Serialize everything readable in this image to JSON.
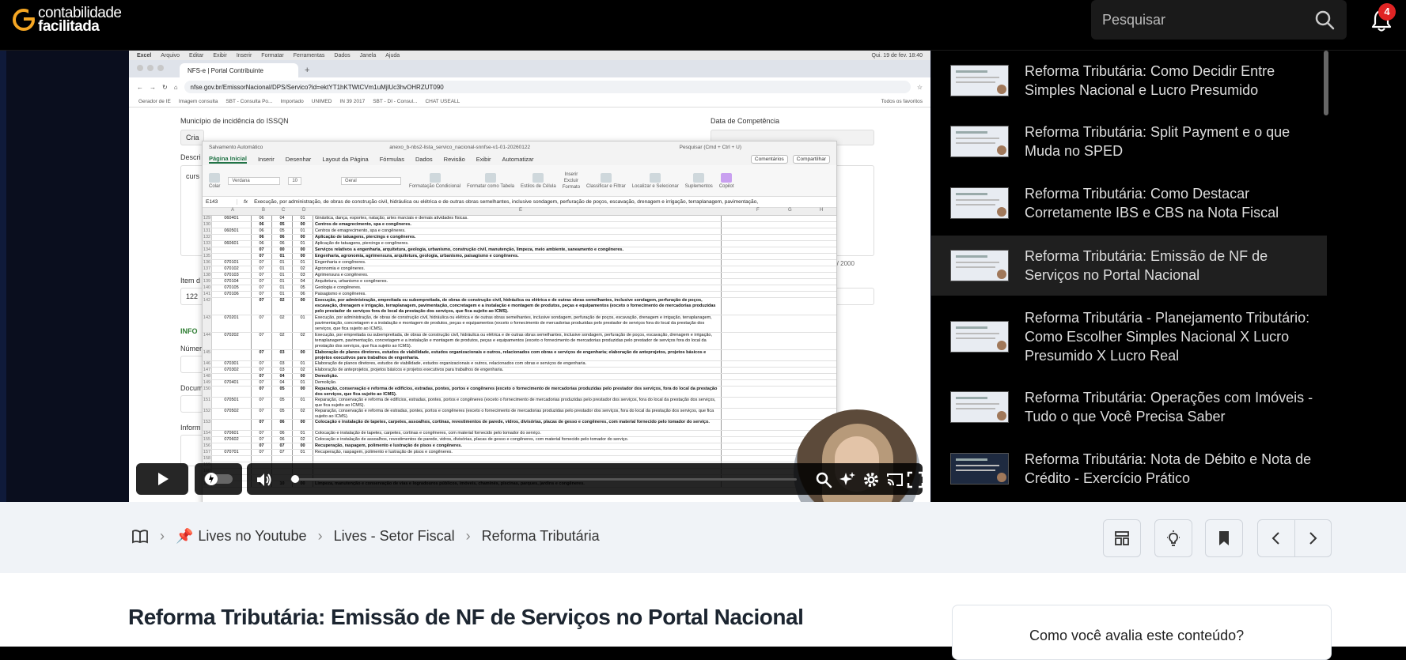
{
  "header": {
    "logo_line1": "contabilidade",
    "logo_line2": "facilitada",
    "search_placeholder": "Pesquisar",
    "notification_count": "4"
  },
  "video": {
    "screen": {
      "mac_menu": [
        "Excel",
        "Arquivo",
        "Editar",
        "Exibir",
        "Inserir",
        "Formatar",
        "Ferramentas",
        "Dados",
        "Janela",
        "Ajuda"
      ],
      "mac_clock": "Qui. 19 de fev. 18:40",
      "browser_tab": "NFS-e | Portal Contribuinte",
      "url": "nfse.gov.br/EmissorNacional/DPS/Servico?id=ektYT1hKTWtCVm1uMjlUc3hvOHRZUT090",
      "bookmarks": [
        "Gerador de IE",
        "Imagem consulta",
        "SBT - Consulta Po...",
        "Importado",
        "UNIMED",
        "IN 39 2017",
        "SBT - DI - Consul...",
        "CHAT USEALL"
      ],
      "bookmarks_right": "Todos os favoritos",
      "form": {
        "municipio_label": "Município de incidência do ISSQN",
        "data_competencia_label": "Data de Competência",
        "criar_prefix": "Cria",
        "descr_label": "Descri",
        "curso_prefix": "curs",
        "chars_counter": "res: 66 / 2000",
        "item_label": "Item d",
        "item_value": "122",
        "info_label": "INFO",
        "numero_label": "Númer",
        "documento_label": "Docum",
        "informacoes_label": "Inform"
      },
      "excel": {
        "title": "anexo_b-nbs2-lista_servico_nacional-snnfse-v1-01-20260122",
        "autosave": "Salvamento Automático",
        "search": "Pesquisar (Cmd + Ctrl + U)",
        "menu": [
          "Página Inicial",
          "Inserir",
          "Desenhar",
          "Layout da Página",
          "Fórmulas",
          "Dados",
          "Revisão",
          "Exibir",
          "Automatizar"
        ],
        "comments_btn": "Comentários",
        "share_btn": "Compartilhar",
        "ribbon": [
          "Colar",
          "Verdana",
          "10",
          "Geral",
          "Formatação Condicional",
          "Formatar como Tabela",
          "Estilos de Célula",
          "Inserir",
          "Excluir",
          "Formato",
          "Classificar e Filtrar",
          "Localizar e Selecionar",
          "Suplementos",
          "Copilot"
        ],
        "cell_ref": "E143",
        "formula": "Execução, por administração, de obras de construção civil, hidráulica ou elétrica e de outras obras semelhantes, inclusive sondagem, perfuração de poços, escavação, drenagem e irrigação, terraplanagem, pavimentação,",
        "columns": [
          "A",
          "B",
          "C",
          "D",
          "E",
          "F",
          "G",
          "H"
        ],
        "rows": [
          {
            "n": "129",
            "a": "060401",
            "b": "06",
            "c": "04",
            "d": "01",
            "e": "Ginástica, dança, esportes, natação, artes marciais e demais atividades físicas.",
            "bold": false
          },
          {
            "n": "130",
            "a": "",
            "b": "06",
            "c": "05",
            "d": "00",
            "e": "Centros de emagrecimento, spa e congêneres.",
            "bold": true
          },
          {
            "n": "131",
            "a": "060501",
            "b": "06",
            "c": "05",
            "d": "01",
            "e": "Centros de emagrecimento, spa e congêneres.",
            "bold": false
          },
          {
            "n": "132",
            "a": "",
            "b": "06",
            "c": "06",
            "d": "00",
            "e": "Aplicação de tatuagens, piercings e congêneres.",
            "bold": true
          },
          {
            "n": "133",
            "a": "060601",
            "b": "06",
            "c": "06",
            "d": "01",
            "e": "Aplicação de tatuagens, piercings e congêneres.",
            "bold": false
          },
          {
            "n": "134",
            "a": "",
            "b": "07",
            "c": "00",
            "d": "00",
            "e": "Serviços relativos a engenharia, arquitetura, geologia, urbanismo, construção civil, manutenção, limpeza, meio ambiente, saneamento e congêneres.",
            "bold": true
          },
          {
            "n": "135",
            "a": "",
            "b": "07",
            "c": "01",
            "d": "00",
            "e": "Engenharia, agronomia, agrimensura, arquitetura, geologia, urbanismo, paisagismo e congêneres.",
            "bold": true
          },
          {
            "n": "136",
            "a": "070101",
            "b": "07",
            "c": "01",
            "d": "01",
            "e": "Engenharia e congêneres.",
            "bold": false
          },
          {
            "n": "137",
            "a": "070102",
            "b": "07",
            "c": "01",
            "d": "02",
            "e": "Agronomia e congêneres.",
            "bold": false
          },
          {
            "n": "138",
            "a": "070103",
            "b": "07",
            "c": "01",
            "d": "03",
            "e": "Agrimensura e congêneres.",
            "bold": false
          },
          {
            "n": "139",
            "a": "070104",
            "b": "07",
            "c": "01",
            "d": "04",
            "e": "Arquitetura, urbanismo e congêneres.",
            "bold": false
          },
          {
            "n": "140",
            "a": "070105",
            "b": "07",
            "c": "01",
            "d": "05",
            "e": "Geologia e congêneres.",
            "bold": false
          },
          {
            "n": "141",
            "a": "070106",
            "b": "07",
            "c": "01",
            "d": "06",
            "e": "Paisagismo e congêneres.",
            "bold": false
          },
          {
            "n": "142",
            "a": "",
            "b": "07",
            "c": "02",
            "d": "00",
            "e": "Execução, por administração, empreitada ou subempreitada, de obras de construção civil, hidráulica ou elétrica e de outras obras semelhantes, inclusive sondagem, perfuração de poços, escavação, drenagem e irrigação, terraplanagem, pavimentação, concretagem e a instalação e montagem de produtos, peças e equipamentos (exceto o fornecimento de mercadorias produzidas pelo prestador de serviços fora do local da prestação dos serviços, que fica sujeito ao ICMS).",
            "bold": true,
            "h": "tall"
          },
          {
            "n": "143",
            "a": "070201",
            "b": "07",
            "c": "02",
            "d": "01",
            "e": "Execução, por administração, de obras de construção civil, hidráulica ou elétrica e de outras obras semelhantes, inclusive sondagem, perfuração de poços, escavação, drenagem e irrigação, terraplanagem, pavimentação, concretagem e a instalação e montagem de produtos, peças e equipamentos (exceto o fornecimento de mercadorias produzidas pelo prestador de serviços fora do local da prestação dos serviços, que fica sujeito ao ICMS).",
            "bold": false,
            "h": "tall"
          },
          {
            "n": "144",
            "a": "070202",
            "b": "07",
            "c": "02",
            "d": "02",
            "e": "Execução, por empreitada ou subempreitada, de obras de construção civil, hidráulica ou elétrica e de outras obras semelhantes, inclusive sondagem, perfuração de poços, escavação, drenagem e irrigação, terraplanagem, pavimentação, concretagem e a instalação e montagem de produtos, peças e equipamentos (exceto o fornecimento de mercadorias produzidas pelo prestador de serviços fora do local da prestação dos serviços, que fica sujeito ao ICMS).",
            "bold": false,
            "h": "tall"
          },
          {
            "n": "145",
            "a": "",
            "b": "07",
            "c": "03",
            "d": "00",
            "e": "Elaboração de planos diretores, estudos de viabilidade, estudos organizacionais e outros, relacionados com obras e serviços de engenharia; elaboração de anteprojetos, projetos básicos e projetos executivos para trabalhos de engenharia.",
            "bold": true,
            "h": "mid"
          },
          {
            "n": "146",
            "a": "070301",
            "b": "07",
            "c": "03",
            "d": "01",
            "e": "Elaboração de planos diretores, estudos de viabilidade, estudos organizacionais e outros, relacionados com obras e serviços de engenharia.",
            "bold": false
          },
          {
            "n": "147",
            "a": "070302",
            "b": "07",
            "c": "03",
            "d": "02",
            "e": "Elaboração de anteprojetos, projetos básicos e projetos executivos para trabalhos de engenharia.",
            "bold": false
          },
          {
            "n": "148",
            "a": "",
            "b": "07",
            "c": "04",
            "d": "00",
            "e": "Demolição.",
            "bold": true
          },
          {
            "n": "149",
            "a": "070401",
            "b": "07",
            "c": "04",
            "d": "01",
            "e": "Demolição.",
            "bold": false
          },
          {
            "n": "150",
            "a": "",
            "b": "07",
            "c": "05",
            "d": "00",
            "e": "Reparação, conservação e reforma de edifícios, estradas, pontes, portos e congêneres (exceto o fornecimento de mercadorias produzidas pelo prestador dos serviços, fora do local da prestação dos serviços, que fica sujeito ao ICMS).",
            "bold": true,
            "h": "mid"
          },
          {
            "n": "151",
            "a": "070501",
            "b": "07",
            "c": "05",
            "d": "01",
            "e": "Reparação, conservação e reforma de edifícios, estradas, pontes, portos e congêneres (exceto o fornecimento de mercadorias produzidas pelo prestador dos serviços, fora do local da prestação dos serviços, que fica sujeito ao ICMS).",
            "bold": false,
            "h": "mid"
          },
          {
            "n": "152",
            "a": "070502",
            "b": "07",
            "c": "05",
            "d": "02",
            "e": "Reparação, conservação e reforma de estradas, pontes, portos e congêneres (exceto o fornecimento de mercadorias produzidas pelo prestador dos serviços, fora do local da prestação dos serviços, que fica sujeito ao ICMS).",
            "bold": false,
            "h": "mid"
          },
          {
            "n": "153",
            "a": "",
            "b": "07",
            "c": "06",
            "d": "00",
            "e": "Colocação e instalação de tapetes, carpetes, assoalhos, cortinas, revestimentos de parede, vidros, divisórias, placas de gesso e congêneres, com material fornecido pelo tomador do serviço.",
            "bold": true,
            "h": "mid"
          },
          {
            "n": "154",
            "a": "070601",
            "b": "07",
            "c": "06",
            "d": "01",
            "e": "Colocação e instalação de tapetes, carpetes, cortinas e congêneres, com material fornecido pelo tomador do serviço.",
            "bold": false
          },
          {
            "n": "155",
            "a": "070602",
            "b": "07",
            "c": "06",
            "d": "02",
            "e": "Colocação e instalação de assoalhos, revestimentos de parede, vidros, divisórias, placas de gesso e congêneres, com material fornecido pelo tomador do serviço.",
            "bold": false
          },
          {
            "n": "156",
            "a": "",
            "b": "07",
            "c": "07",
            "d": "00",
            "e": "Recuperação, raspagem, polimento e lustração de pisos e congêneres.",
            "bold": true
          },
          {
            "n": "157",
            "a": "070701",
            "b": "07",
            "c": "07",
            "d": "01",
            "e": "Recuperação, raspagem, polimento e lustração de pisos e congêneres.",
            "bold": false
          },
          {
            "n": "158",
            "a": "",
            "b": "",
            "c": "",
            "d": "",
            "e": "",
            "bold": false
          },
          {
            "n": "159",
            "a": "",
            "b": "",
            "c": "",
            "d": "",
            "e": "",
            "bold": false
          },
          {
            "n": "160",
            "a": "",
            "b": "",
            "c": "",
            "d": "",
            "e": "",
            "bold": false
          },
          {
            "n": "161",
            "a": "",
            "b": "",
            "c": "",
            "d": "",
            "e": "",
            "bold": false
          },
          {
            "n": "162",
            "a": "",
            "b": "07",
            "c": "10",
            "d": "00",
            "e": "Limpeza, manutenção e conservação de vias e logradouros públicos, imóveis, chaminés, piscinas, parques, jardins e congêneres.",
            "bold": true
          }
        ]
      }
    },
    "progress": 0.01
  },
  "playlist": [
    {
      "title": "Reforma Tributária: Como Decidir Entre Simples Nacional e Lucro Presumido",
      "active": false
    },
    {
      "title": "Reforma Tributária: Split Payment e o que Muda no SPED",
      "active": false
    },
    {
      "title": "Reforma Tributária: Como Destacar Corretamente IBS e CBS na Nota Fiscal",
      "active": false
    },
    {
      "title": "Reforma Tributária: Emissão de NF de Serviços no Portal Nacional",
      "active": true
    },
    {
      "title": "Reforma Tributária - Planejamento Tributário: Como Escolher Simples Nacional X Lucro Presumido X Lucro Real",
      "active": false
    },
    {
      "title": "Reforma Tributária: Operações com Imóveis - Tudo o que Você Precisa Saber",
      "active": false
    },
    {
      "title": "Reforma Tributária: Nota de Débito e Nota de Crédito - Exercício Prático",
      "active": false
    }
  ],
  "breadcrumb": {
    "items": [
      "Lives no Youtube",
      "Lives - Setor Fiscal",
      "Reforma Tributária"
    ],
    "pin_icon": "📌"
  },
  "content": {
    "title": "Reforma Tributária: Emissão de NF de Serviços no Portal Nacional",
    "rating_question": "Como você avalia este conteúdo?"
  },
  "colors": {
    "accent_orange": "#f5a623",
    "badge_red": "#e02424"
  }
}
